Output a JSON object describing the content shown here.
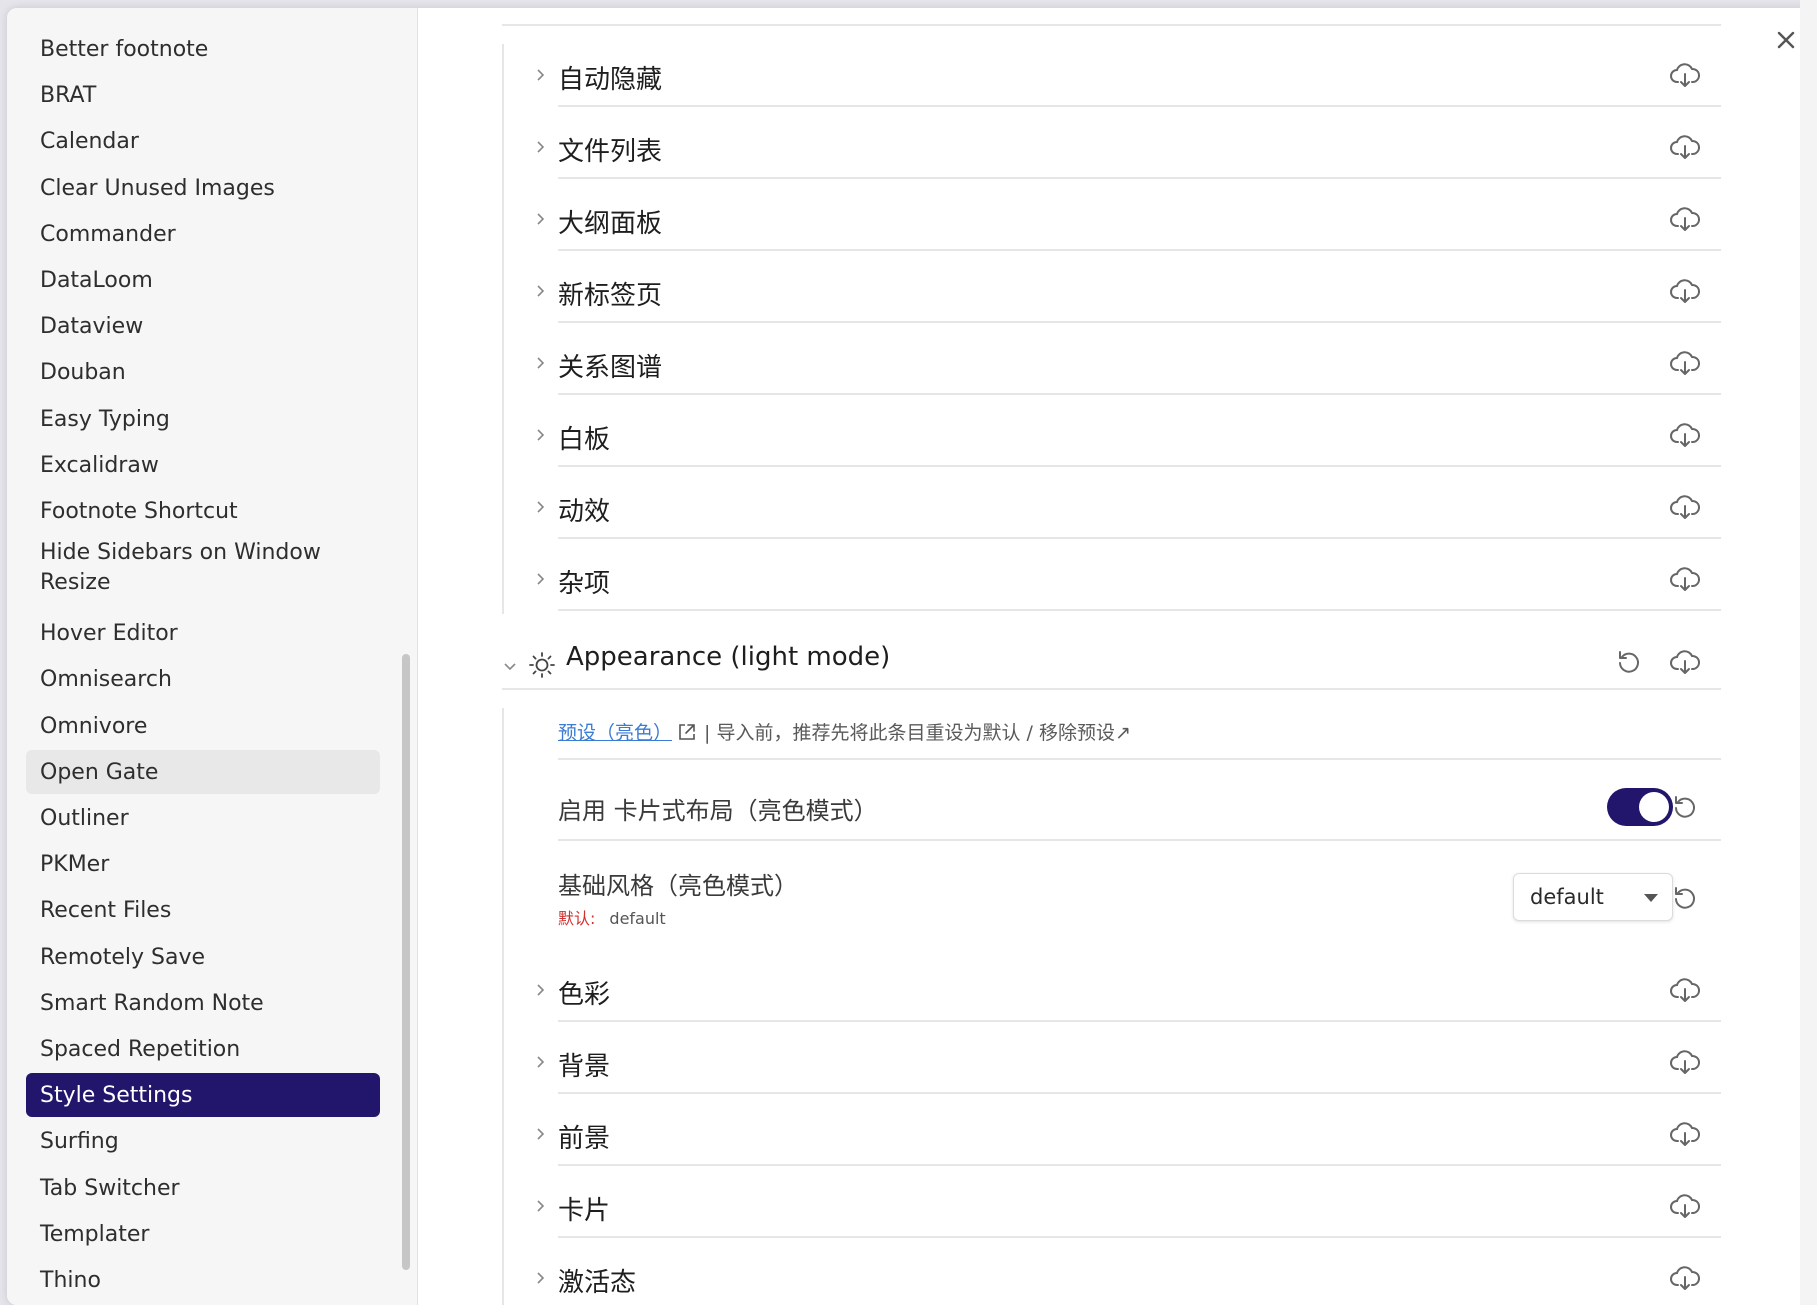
{
  "sidebar": {
    "items": [
      {
        "label": "Better footnote"
      },
      {
        "label": "BRAT"
      },
      {
        "label": "Calendar"
      },
      {
        "label": "Clear Unused Images"
      },
      {
        "label": "Commander"
      },
      {
        "label": "DataLoom"
      },
      {
        "label": "Dataview"
      },
      {
        "label": "Douban"
      },
      {
        "label": "Easy Typing"
      },
      {
        "label": "Excalidraw"
      },
      {
        "label": "Footnote Shortcut"
      },
      {
        "label": "Hide Sidebars on Window Resize"
      },
      {
        "label": "Hover Editor"
      },
      {
        "label": "Omnisearch"
      },
      {
        "label": "Omnivore"
      },
      {
        "label": "Open Gate"
      },
      {
        "label": "Outliner"
      },
      {
        "label": "PKMer"
      },
      {
        "label": "Recent Files"
      },
      {
        "label": "Remotely Save"
      },
      {
        "label": "Smart Random Note"
      },
      {
        "label": "Spaced Repetition"
      },
      {
        "label": "Style Settings"
      },
      {
        "label": "Surfing"
      },
      {
        "label": "Tab Switcher"
      },
      {
        "label": "Templater"
      },
      {
        "label": "Thino"
      }
    ],
    "active": "Style Settings",
    "hovered": "Open Gate"
  },
  "groups_upper": [
    {
      "label": "自动隐藏"
    },
    {
      "label": "文件列表"
    },
    {
      "label": "大纲面板"
    },
    {
      "label": "新标签页"
    },
    {
      "label": "关系图谱"
    },
    {
      "label": "白板"
    },
    {
      "label": "动效"
    },
    {
      "label": "杂项"
    }
  ],
  "section": {
    "title": "Appearance (light mode)",
    "preset_link": "预设（亮色）",
    "preset_note": "| 导入前，推荐先将此条目重设为默认 / 移除预设↗",
    "card_layout": {
      "label": "启用 卡片式布局（亮色模式）",
      "enabled": true
    },
    "base_style": {
      "label": "基础风格（亮色模式）",
      "value": "default",
      "default_key": "默认:",
      "default_value": "default"
    }
  },
  "groups_lower": [
    {
      "label": "色彩"
    },
    {
      "label": "背景"
    },
    {
      "label": "前景"
    },
    {
      "label": "卡片"
    },
    {
      "label": "激活态"
    }
  ],
  "colors": {
    "accent": "#21166c",
    "link": "#3a7bd5",
    "default_key": "#d03030"
  }
}
